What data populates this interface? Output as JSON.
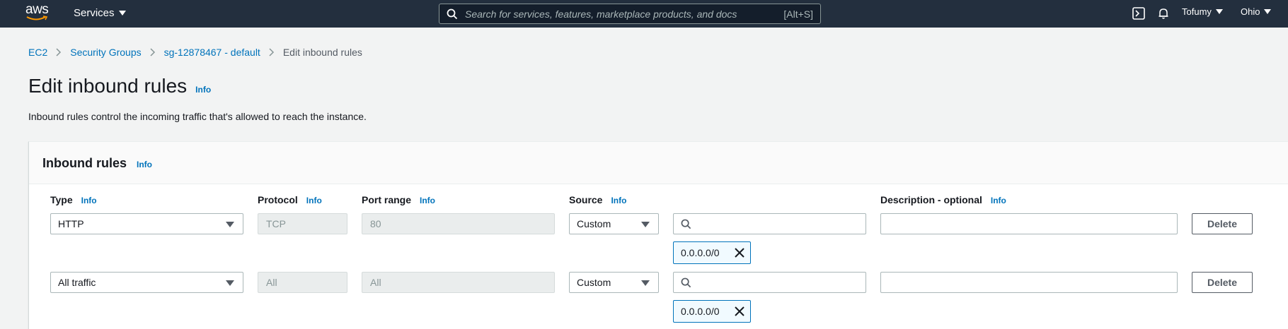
{
  "topnav": {
    "logo_text": "aws",
    "services_label": "Services",
    "search_placeholder": "Search for services, features, marketplace products, and docs",
    "search_shortcut": "[Alt+S]",
    "account_label": "Tofumy",
    "region_label": "Ohio",
    "bg_color": "#232f3e"
  },
  "breadcrumb": {
    "items": [
      "EC2",
      "Security Groups",
      "sg-12878467 - default"
    ],
    "current": "Edit inbound rules"
  },
  "page": {
    "title": "Edit inbound rules",
    "title_info": "Info",
    "description": "Inbound rules control the incoming traffic that's allowed to reach the instance."
  },
  "panel": {
    "title": "Inbound rules",
    "info": "Info",
    "columns": {
      "type": "Type",
      "protocol": "Protocol",
      "port_range": "Port range",
      "source": "Source",
      "description": "Description - optional",
      "info": "Info"
    },
    "rules": [
      {
        "type": "HTTP",
        "protocol": "TCP",
        "port_range": "80",
        "source_type": "Custom",
        "source_search": "",
        "source_token": "0.0.0.0/0",
        "description": "",
        "delete_label": "Delete"
      },
      {
        "type": "All traffic",
        "protocol": "All",
        "port_range": "All",
        "source_type": "Custom",
        "source_search": "",
        "source_token": "0.0.0.0/0",
        "description": "",
        "delete_label": "Delete"
      }
    ]
  },
  "colors": {
    "link": "#0073bb",
    "page_bg": "#f2f3f3",
    "token_border": "#0073bb"
  }
}
